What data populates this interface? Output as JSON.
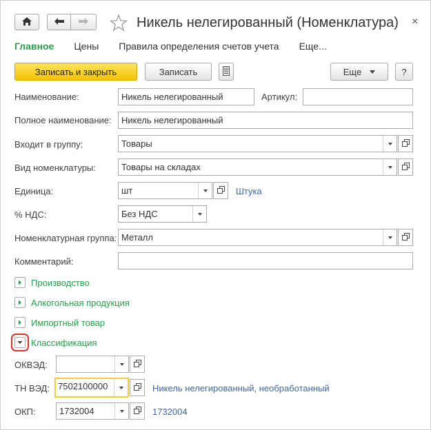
{
  "window": {
    "title": "Никель нелегированный (Номенклатура)",
    "close": "×"
  },
  "tabs": [
    {
      "label": "Главное",
      "active": true
    },
    {
      "label": "Цены"
    },
    {
      "label": "Правила определения счетов учета"
    },
    {
      "label": "Еще..."
    }
  ],
  "toolbar": {
    "save_close": "Записать и закрыть",
    "save": "Записать",
    "more": "Еще",
    "help": "?"
  },
  "form": {
    "name_label": "Наименование:",
    "name_value": "Никель нелегированный",
    "article_label": "Артикул:",
    "article_value": "",
    "fullname_label": "Полное наименование:",
    "fullname_value": "Никель нелегированный",
    "group_label": "Входит в группу:",
    "group_value": "Товары",
    "kind_label": "Вид номенклатуры:",
    "kind_value": "Товары на складах",
    "unit_label": "Единица:",
    "unit_value": "шт",
    "unit_link": "Штука",
    "vat_label": "% НДС:",
    "vat_value": "Без НДС",
    "nomgroup_label": "Номенклатурная группа:",
    "nomgroup_value": "Металл",
    "comment_label": "Комментарий:",
    "comment_value": ""
  },
  "sections": {
    "production": "Производство",
    "alcohol": "Алкогольная продукция",
    "import": "Импортный товар",
    "classification": "Классификация"
  },
  "classification": {
    "okved_label": "ОКВЭД:",
    "okved_value": "",
    "tnved_label": "ТН ВЭД:",
    "tnved_value": "7502100000",
    "tnved_link": "Никель нелегированный, необработанный",
    "okp_label": "ОКП:",
    "okp_value": "1732004",
    "okp_link": "1732004"
  },
  "colors": {
    "accent_green": "#24a147",
    "link_blue": "#3d68a8",
    "primary_yellow": "#f3c200",
    "highlight_red": "#d93030"
  }
}
